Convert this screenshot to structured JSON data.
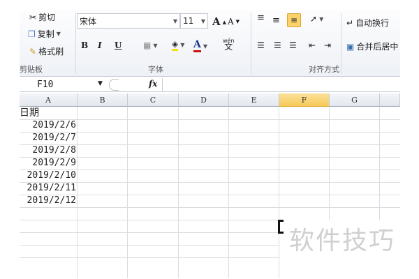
{
  "ribbon": {
    "clipboard": {
      "cut": "剪切",
      "copy": "复制",
      "format_painter": "格式刷",
      "label": "剪贴板"
    },
    "font": {
      "font_name": "宋体",
      "font_size": "11",
      "bold": "B",
      "italic": "I",
      "underline": "U",
      "font_color": "A",
      "label": "字体",
      "phonetic": "wén"
    },
    "alignment": {
      "wrap_text": "自动换行",
      "merge_center": "合并后居中",
      "label": "对齐方式"
    }
  },
  "formula_bar": {
    "name_box": "F10",
    "fx": "fx",
    "formula": ""
  },
  "sheet": {
    "columns": [
      "A",
      "B",
      "C",
      "D",
      "E",
      "F",
      "G"
    ],
    "selected_column": "F",
    "cells_a": [
      "日期",
      "2019/2/6",
      "2019/2/7",
      "2019/2/8",
      "2019/2/9",
      "2019/2/10",
      "2019/2/11",
      "2019/2/12"
    ]
  },
  "watermark": "软件技巧",
  "colors": {
    "selected_header": "#f6c95a",
    "grid": "#d9dce0",
    "accent_fill": "#f5e10a",
    "font_red": "#d01010"
  }
}
